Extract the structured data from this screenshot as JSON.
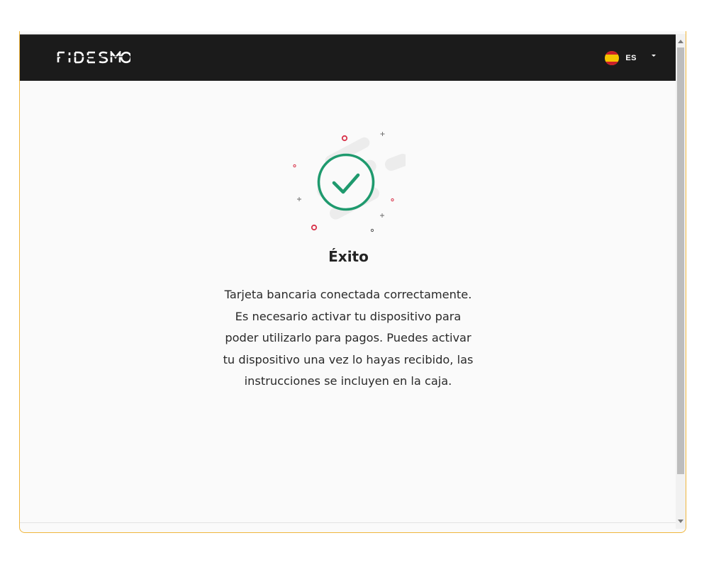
{
  "header": {
    "logo_text": "FIDESMO",
    "language": {
      "code": "ES",
      "flag_icon": "spain-flag-icon"
    }
  },
  "result": {
    "icon": "success-check-icon",
    "title": "Éxito",
    "message_lines": [
      "Tarjeta bancaria conectada correctamente.",
      "Es necesario activar tu dispositivo para",
      "poder utilizarlo para pagos. Puedes activar",
      "tu dispositivo una vez lo hayas recibido, las",
      "instrucciones se incluyen en la caja."
    ]
  },
  "colors": {
    "header_bg": "#1b1b1b",
    "success_green": "#1f9a6e",
    "accent_red": "#d8334a",
    "frame_border": "#f0b63c"
  }
}
